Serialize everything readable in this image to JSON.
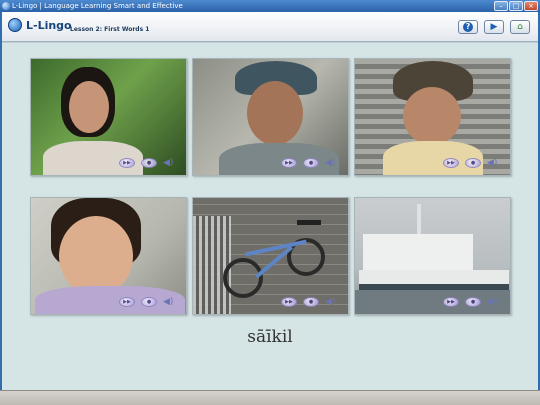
{
  "window": {
    "title": "L-Lingo | Language Learning Smart and Effective",
    "buttons": [
      "minimize",
      "maximize",
      "close"
    ]
  },
  "header": {
    "logo_text": "L-Lingo",
    "lesson_title": "Lesson 2: First Words 1",
    "buttons": [
      {
        "name": "help",
        "icon": "question-icon"
      },
      {
        "name": "next",
        "icon": "play-arrow-icon"
      },
      {
        "name": "home",
        "icon": "home-icon"
      }
    ]
  },
  "tiles": [
    {
      "subject": "woman",
      "icons": [
        "play-icon",
        "record-icon",
        "speaker-icon"
      ]
    },
    {
      "subject": "man in hat",
      "icons": [
        "play-icon",
        "record-icon",
        "speaker-icon"
      ]
    },
    {
      "subject": "boy in cap",
      "icons": [
        "play-icon",
        "record-icon",
        "speaker-icon"
      ]
    },
    {
      "subject": "girl",
      "icons": [
        "play-icon",
        "record-icon",
        "speaker-icon"
      ]
    },
    {
      "subject": "bicycle",
      "icons": [
        "play-icon",
        "record-icon",
        "speaker-icon"
      ]
    },
    {
      "subject": "ship",
      "icons": [
        "play-icon",
        "record-icon",
        "speaker-icon"
      ]
    }
  ],
  "word": "sāīkil",
  "colors": {
    "accent": "#2f6fb0",
    "content_bg": "#d5e5e6"
  }
}
